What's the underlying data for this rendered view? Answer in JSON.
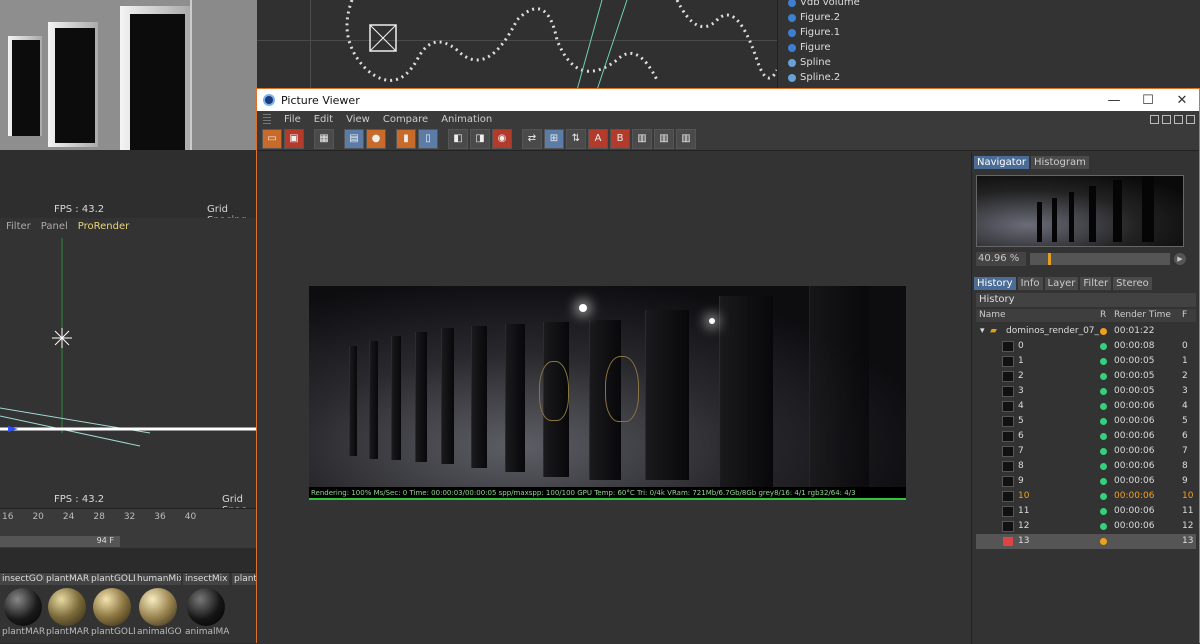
{
  "background": {
    "viewport_top": {
      "fps": "FPS : 43.2",
      "grid": "Grid Spacing"
    },
    "viewport_bottom": {
      "menu": [
        "Filter",
        "Panel",
        "ProRender"
      ],
      "fps": "FPS : 43.2",
      "grid": "Grid Spac"
    },
    "objects": [
      {
        "name": "Vdb volume"
      },
      {
        "name": "Figure.2"
      },
      {
        "name": "Figure.1"
      },
      {
        "name": "Figure"
      },
      {
        "name": "Spline"
      },
      {
        "name": "Spline.2"
      }
    ],
    "timeline": {
      "ticks": [
        "16",
        "20",
        "24",
        "28",
        "32",
        "36",
        "40"
      ],
      "frame_field": "94 F"
    },
    "materials": [
      {
        "label": "insectGOLD",
        "label2": "plantMARB",
        "color": "#1a1a1a"
      },
      {
        "label": "plantMARB",
        "label2": "plantMARB",
        "color": "#7a6a3a"
      },
      {
        "label": "plantGOLD",
        "label2": "plantGOLD",
        "color": "#8a7440"
      },
      {
        "label": "humanMix",
        "label2": "animalGOLD",
        "color": "#9a8450"
      },
      {
        "label": "insectMix",
        "label2": "animalMARB",
        "color": "#151515"
      },
      {
        "label": "plant",
        "label2": "",
        "color": "#333"
      }
    ]
  },
  "picture_viewer": {
    "title": "Picture Viewer",
    "window_buttons": [
      "—",
      "☐",
      "✕"
    ],
    "menu": [
      "File",
      "Edit",
      "View",
      "Compare",
      "Animation"
    ],
    "render_status": "Rendering: 100% Ms/Sec: 0  Time: 00:00:03/00:00:05  spp/maxspp: 100/100  GPU  Temp: 60°C  Tri: 0/4k  VRam: 721Mb/6.7Gb/8Gb  grey8/16: 4/1  rgb32/64: 4/3",
    "side_tabs_top": [
      "Navigator",
      "Histogram"
    ],
    "zoom": "40.96 %",
    "zoom_fraction": 0.13,
    "side_tabs": [
      "History",
      "Info",
      "Layer",
      "Filter",
      "Stereo"
    ],
    "history": {
      "title": "History",
      "columns": [
        "Name",
        "R",
        "Render Time",
        "F"
      ],
      "group": {
        "name": "dominos_render_07_",
        "time": "00:01:22",
        "status_color": "#f0a020"
      },
      "rows": [
        {
          "name": "0",
          "time": "00:00:08",
          "frame": "0",
          "status_color": "#36d07a"
        },
        {
          "name": "1",
          "time": "00:00:05",
          "frame": "1",
          "status_color": "#36d07a"
        },
        {
          "name": "2",
          "time": "00:00:05",
          "frame": "2",
          "status_color": "#36d07a"
        },
        {
          "name": "3",
          "time": "00:00:05",
          "frame": "3",
          "status_color": "#36d07a"
        },
        {
          "name": "4",
          "time": "00:00:06",
          "frame": "4",
          "status_color": "#36d07a"
        },
        {
          "name": "5",
          "time": "00:00:06",
          "frame": "5",
          "status_color": "#36d07a"
        },
        {
          "name": "6",
          "time": "00:00:06",
          "frame": "6",
          "status_color": "#36d07a"
        },
        {
          "name": "7",
          "time": "00:00:06",
          "frame": "7",
          "status_color": "#36d07a"
        },
        {
          "name": "8",
          "time": "00:00:06",
          "frame": "8",
          "status_color": "#36d07a"
        },
        {
          "name": "9",
          "time": "00:00:06",
          "frame": "9",
          "status_color": "#36d07a"
        },
        {
          "name": "10",
          "time": "00:00:06",
          "frame": "10",
          "status_color": "#36d07a",
          "highlight": true
        },
        {
          "name": "11",
          "time": "00:00:06",
          "frame": "11",
          "status_color": "#36d07a"
        },
        {
          "name": "12",
          "time": "00:00:06",
          "frame": "12",
          "status_color": "#36d07a"
        },
        {
          "name": "13",
          "time": "",
          "frame": "13",
          "status_color": "#f0a020",
          "selected": true
        }
      ]
    }
  },
  "colors": {
    "window_border": "#e07028",
    "accent_tab": "#4b6c96",
    "status_ok": "#36d07a",
    "status_busy": "#f0a020"
  }
}
